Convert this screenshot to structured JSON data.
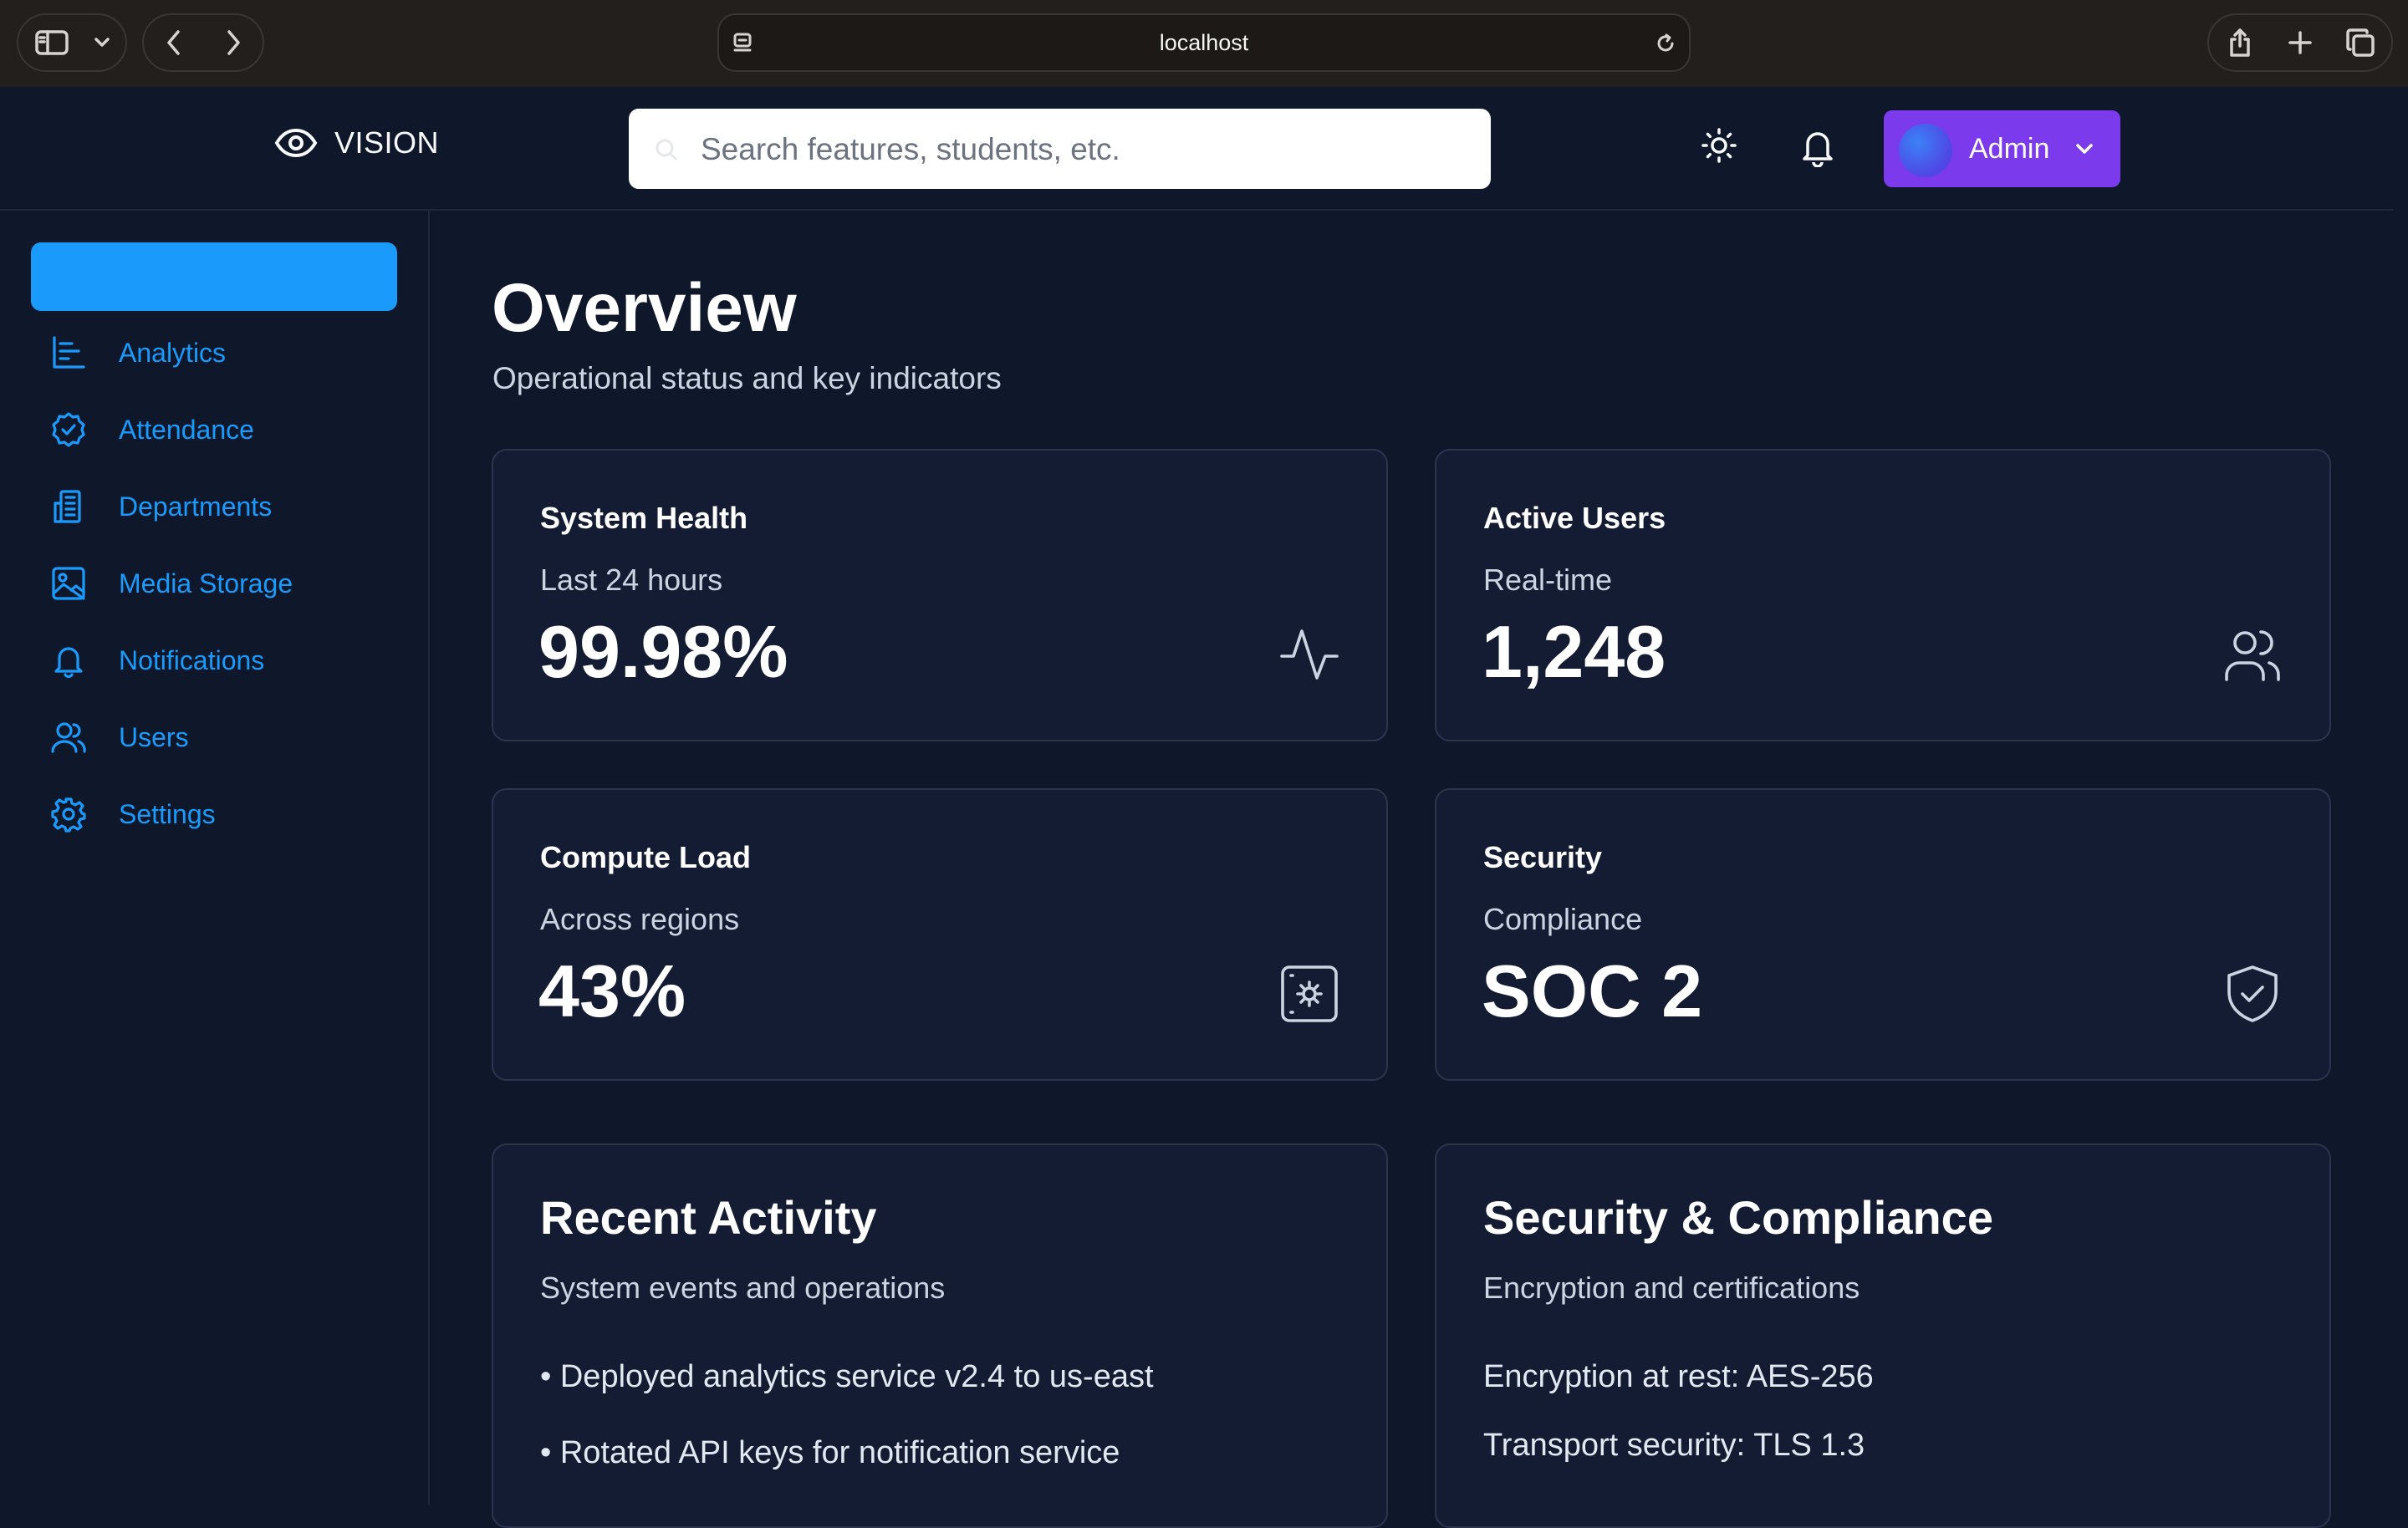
{
  "browser": {
    "address": "localhost"
  },
  "header": {
    "brand": "VISION",
    "search_placeholder": "Search features, students, etc.",
    "user_label": "Admin"
  },
  "sidebar": {
    "items": [
      {
        "label": "Analytics",
        "icon": "bar-chart-icon"
      },
      {
        "label": "Attendance",
        "icon": "badge-check-icon"
      },
      {
        "label": "Departments",
        "icon": "building-icon"
      },
      {
        "label": "Media Storage",
        "icon": "image-icon"
      },
      {
        "label": "Notifications",
        "icon": "bell-icon"
      },
      {
        "label": "Users",
        "icon": "users-icon"
      },
      {
        "label": "Settings",
        "icon": "gear-icon"
      }
    ],
    "accent": "#1a9bfc"
  },
  "main": {
    "title": "Overview",
    "subtitle": "Operational status and key indicators",
    "stats": [
      {
        "title": "System Health",
        "subtitle": "Last 24 hours",
        "value": "99.98%",
        "icon": "activity-icon"
      },
      {
        "title": "Active Users",
        "subtitle": "Real-time",
        "value": "1,248",
        "icon": "users-icon"
      },
      {
        "title": "Compute Load",
        "subtitle": "Across regions",
        "value": "43%",
        "icon": "server-cog-icon"
      },
      {
        "title": "Security",
        "subtitle": "Compliance",
        "value": "SOC 2",
        "icon": "shield-check-icon"
      }
    ],
    "recent_activity": {
      "title": "Recent Activity",
      "subtitle": "System events and operations",
      "items": [
        "• Deployed analytics service v2.4 to us-east",
        "• Rotated API keys for notification service"
      ]
    },
    "security_compliance": {
      "title": "Security & Compliance",
      "subtitle": "Encryption and certifications",
      "items": [
        "Encryption at rest: AES-256",
        "Transport security: TLS 1.3"
      ]
    }
  },
  "colors": {
    "background": "#0f172a",
    "card": "#141c33",
    "admin_button": "#7c3aed"
  }
}
